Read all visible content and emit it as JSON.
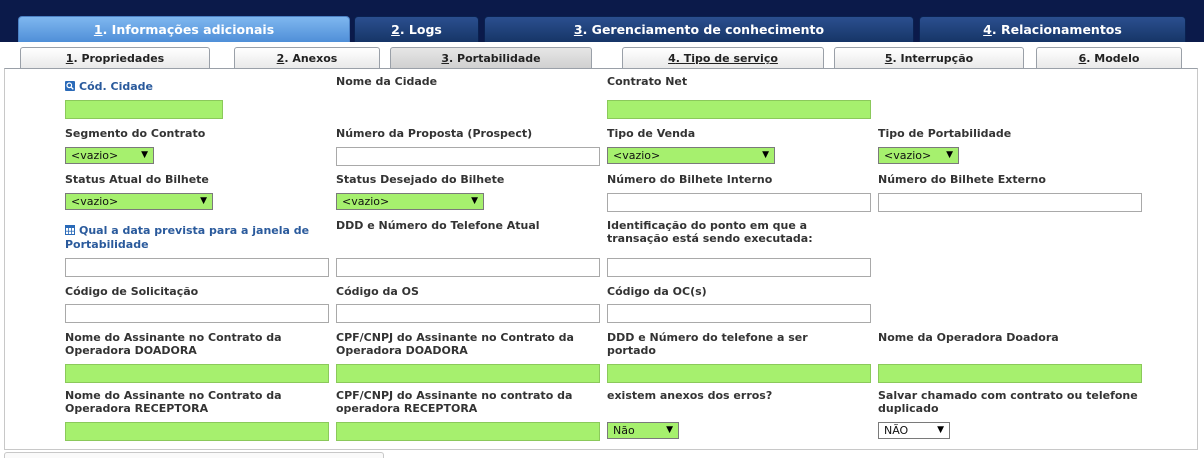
{
  "main_tabs": [
    {
      "num": "1",
      "label": ". Informações adicionais",
      "active": true
    },
    {
      "num": "2",
      "label": ". Logs",
      "active": false
    },
    {
      "num": "3",
      "label": ". Gerenciamento de conhecimento",
      "active": false
    },
    {
      "num": "4",
      "label": ". Relacionamentos",
      "active": false
    }
  ],
  "sub_tabs": [
    {
      "num": "1",
      "label": ". Propriedades"
    },
    {
      "num": "2",
      "label": ". Anexos"
    },
    {
      "num": "3",
      "label": ". Portabilidade"
    },
    {
      "num": "4",
      "label": ". Tipo de serviço"
    },
    {
      "num": "5",
      "label": ". Interrupção"
    },
    {
      "num": "6",
      "label": ". Modelo"
    }
  ],
  "fields": {
    "cod_cidade": "Cód. Cidade",
    "nome_cidade": "Nome da Cidade",
    "contrato_net": "Contrato Net",
    "segmento_contrato": "Segmento do Contrato",
    "numero_proposta": "Número da Proposta (Prospect)",
    "tipo_venda": "Tipo de Venda",
    "tipo_portabilidade": "Tipo de Portabilidade",
    "status_atual": "Status Atual do Bilhete",
    "status_desejado": "Status Desejado do Bilhete",
    "bilhete_interno": "Número do Bilhete Interno",
    "bilhete_externo": "Número do Bilhete Externo",
    "data_janela_1": "Qual a data prevista para a janela de",
    "data_janela_2": "Portabilidade",
    "ddd_atual": "DDD e Número do Telefone Atual",
    "identificacao_1": "Identificação do ponto em que a",
    "identificacao_2": "transação está sendo executada:",
    "codigo_solicitacao": "Código de Solicitação",
    "codigo_os": "Código da OS",
    "codigo_oc": "Código da OC(s)",
    "nome_doadora_1": "Nome do Assinante no Contrato da",
    "nome_doadora_2": "Operadora DOADORA",
    "cpf_doadora_1": "CPF/CNPJ do Assinante no Contrato da",
    "cpf_doadora_2": "Operadora DOADORA",
    "ddd_portado_1": "DDD e Número do telefone a ser",
    "ddd_portado_2": "portado",
    "operadora_doadora": "Nome da Operadora Doadora",
    "nome_receptora_1": "Nome do Assinante no Contrato da",
    "nome_receptora_2": "Operadora RECEPTORA",
    "cpf_receptora_1": "CPF/CNPJ do Assinante no contrato da",
    "cpf_receptora_2": "operadora RECEPTORA",
    "anexos_erros": "existem anexos dos erros?",
    "salvar_duplicado_1": "Salvar chamado com contrato ou telefone",
    "salvar_duplicado_2": "duplicado"
  },
  "selects": {
    "segmento_contrato": "<vazio>",
    "tipo_venda": "<vazio>",
    "tipo_portabilidade": "<vazio>",
    "status_atual": "<vazio>",
    "status_desejado": "<vazio>",
    "anexos_erros": "Não",
    "salvar_duplicado": "NÃO"
  },
  "colors": {
    "required": "#a6f06e",
    "header_bg": "#0b1a4a",
    "active_tab": "#5b9be0",
    "link": "#2a5a9c"
  },
  "icons": {
    "search": "search-icon",
    "calendar": "calendar-icon",
    "dropdown": "chevron-down-icon"
  }
}
